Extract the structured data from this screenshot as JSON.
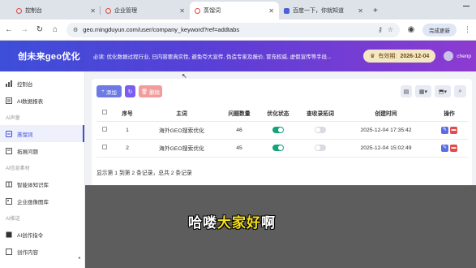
{
  "browser": {
    "tabs": [
      {
        "title": "控制台",
        "active": false
      },
      {
        "title": "企业管理",
        "active": false
      },
      {
        "title": "蒸馏词",
        "active": true
      },
      {
        "title": "百度一下，你就知道",
        "active": false
      }
    ],
    "url": "geo.mingduyun.com/user/company_keyword?ref=addtabs",
    "renew_label": "完成更新"
  },
  "header": {
    "logo": "创未来geo优化",
    "marquee": "必读: 优化数据过程行业, 日内容要真实性, 避免夸大宣传, 伪造专家及报价, 冒充权威, 虚假宣传等手段...",
    "expiry_label": "有效期:",
    "expiry_date": "2026-12-04",
    "username": "chenp"
  },
  "sidebar": {
    "items": [
      {
        "label": "控制台",
        "icon": "chart-icon"
      },
      {
        "label": "AI数据报表",
        "icon": "report-icon"
      },
      {
        "group": "AI声量"
      },
      {
        "label": "蒸馏词",
        "icon": "keyword-icon",
        "active": true
      },
      {
        "label": "拓展问题",
        "icon": "question-icon"
      },
      {
        "group": "AI信息素材"
      },
      {
        "label": "智能体知识库",
        "icon": "book-icon"
      },
      {
        "label": "企业画像图库",
        "icon": "image-icon"
      },
      {
        "group": "AI推送"
      },
      {
        "label": "AI创作指令",
        "icon": "pen-icon"
      },
      {
        "label": "创作内容",
        "icon": "doc-icon"
      }
    ]
  },
  "toolbar": {
    "add_label": "添加",
    "delete_label": "删除"
  },
  "table": {
    "headers": [
      "序号",
      "主词",
      "问题数量",
      "优化状态",
      "查收录拓词",
      "创建时间",
      "操作"
    ],
    "rows": [
      {
        "index": "1",
        "keyword": "海外GEO搜索优化",
        "count": "46",
        "optimize": true,
        "index_expand": false,
        "created": "2025-12-04 17:35:42"
      },
      {
        "index": "2",
        "keyword": "海外GEO搜索优化",
        "count": "45",
        "optimize": true,
        "index_expand": false,
        "created": "2025-12-04 15:02:49"
      }
    ],
    "pager": "显示第 1 到第 2 条记录，总共 2 条记录"
  },
  "subtitle": {
    "part1": "哈喽",
    "highlight": "大家好",
    "part2": "啊"
  }
}
